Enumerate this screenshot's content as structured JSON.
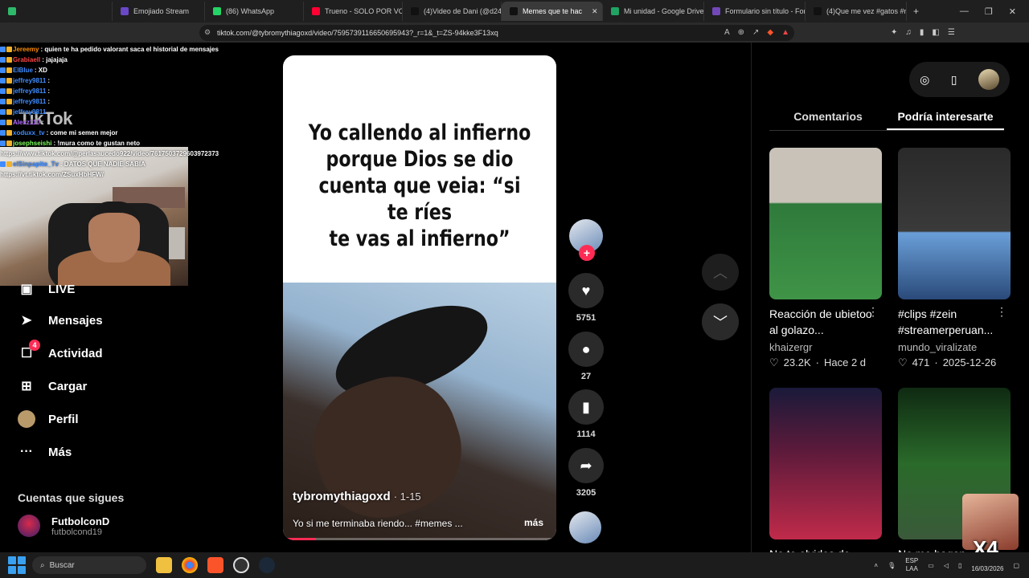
{
  "browser": {
    "tabs": [
      {
        "title": "",
        "color": "#2fb96a",
        "active": false
      },
      {
        "title": "Emojiado Stream",
        "color": "#6a48c8",
        "active": false
      },
      {
        "title": "(86) WhatsApp",
        "color": "#25d366",
        "active": false
      },
      {
        "title": "Trueno - SOLO POR VOS (",
        "color": "#ff0033",
        "active": false
      },
      {
        "title": "(4)Video de Dani (@d248",
        "color": "#111111",
        "active": false
      },
      {
        "title": "Memes que te hac",
        "color": "#111111",
        "active": true
      },
      {
        "title": "Mi unidad - Google Drive",
        "color": "#1fa463",
        "active": false
      },
      {
        "title": "Formulario sin título - For",
        "color": "#7248b9",
        "active": false
      },
      {
        "title": "(4)Que me vez #gatos #m",
        "color": "#111111",
        "active": false
      }
    ],
    "new_tab": "+",
    "url": "tiktok.com/@tybromythiagoxd/video/7595739116650695943?_r=1&_t=ZS-94kke3F13xq",
    "window_controls": [
      "—",
      "❐",
      "✕"
    ]
  },
  "chat": [
    {
      "user": "Jereemy",
      "user_color": "#ff8c00",
      "text": ": quien te ha pedido valorant saca el historial de mensajes"
    },
    {
      "user": "Grabiaell",
      "user_color": "#ff4444",
      "text": ": jajajaja"
    },
    {
      "user": "ElBlue",
      "user_color": "#3f8cff",
      "text": ": XD"
    },
    {
      "user": "jeffrey9811",
      "user_color": "#3f8cff",
      "text": ":"
    },
    {
      "user": "jeffrey9811",
      "user_color": "#3f8cff",
      "text": ":"
    },
    {
      "user": "jeffrey9811",
      "user_color": "#3f8cff",
      "text": ":"
    },
    {
      "user": "jeffrey9811",
      "user_color": "#3f8cff",
      "text": ""
    },
    {
      "user": "Alexz110",
      "user_color": "#b36bff",
      "text": ":"
    },
    {
      "user": "xoduxx_tv",
      "user_color": "#3f8cff",
      "text": ": come mi semen mejor"
    },
    {
      "user": "josephseishi",
      "user_color": "#7cff5a",
      "text": ": !mura como te gustan neto"
    },
    {
      "user": "",
      "user_color": "#ffffff",
      "text": "https://www.tiktok.com/@perlasaucedo922/video/7617503729603972373"
    },
    {
      "user": "elSinpapito_Tv",
      "user_color": "#3f8cff",
      "text": ": DATOS QUE NADIE SABIA"
    },
    {
      "user": "",
      "user_color": "#ffffff",
      "text": "https://vt.tiktok.com/ZSuxHbHFW/"
    }
  ],
  "logo": "TikTok",
  "sidebar": {
    "items": [
      {
        "label": "LIVE",
        "icon": "live-icon",
        "glyph": "▣"
      },
      {
        "label": "Mensajes",
        "icon": "send-icon",
        "glyph": "➤"
      },
      {
        "label": "Actividad",
        "icon": "activity-icon",
        "glyph": "☐",
        "badge": "4"
      },
      {
        "label": "Cargar",
        "icon": "upload-icon",
        "glyph": "⊞"
      },
      {
        "label": "Perfil",
        "icon": "profile-icon",
        "glyph": "●"
      },
      {
        "label": "Más",
        "icon": "more-icon",
        "glyph": "···"
      }
    ],
    "following_title": "Cuentas que sigues",
    "following": [
      {
        "name": "FutbolconD",
        "handle": "futbolcond19"
      }
    ]
  },
  "video": {
    "meme_lines": [
      "Yo callendo al infierno",
      "porque Dios se dio",
      "cuenta que veia: “si te ríes",
      "te vas al infierno”"
    ],
    "author": "tybromythiagoxd",
    "date": "· 1-15",
    "caption": "Yo si me terminaba riendo... #memes ...",
    "more": "más",
    "progress": 0.12
  },
  "actions": {
    "likes": "5751",
    "comments": "27",
    "saves": "1114",
    "shares": "3205"
  },
  "right": {
    "tabs": [
      "Comentarios",
      "Podría interesarte"
    ],
    "active_tab": 1,
    "cards": [
      {
        "title": "Reacción de ubietoo al golazo...",
        "author": "khaizergr",
        "likes": "23.2K",
        "date": "Hace 2 d"
      },
      {
        "title": "#clips #zein #streamerperuan...",
        "author": "mundo_viralizate",
        "likes": "471",
        "date": "2025-12-26"
      },
      {
        "title": "No te olvides de",
        "author": "",
        "likes": "",
        "date": ""
      },
      {
        "title": "No me hagan",
        "author": "",
        "likes": "",
        "date": ""
      }
    ]
  },
  "taskbar": {
    "search": "Buscar",
    "lang_top": "ESP",
    "lang_bottom": "LAA",
    "date": "16/03/2026",
    "overlay": "X4"
  }
}
